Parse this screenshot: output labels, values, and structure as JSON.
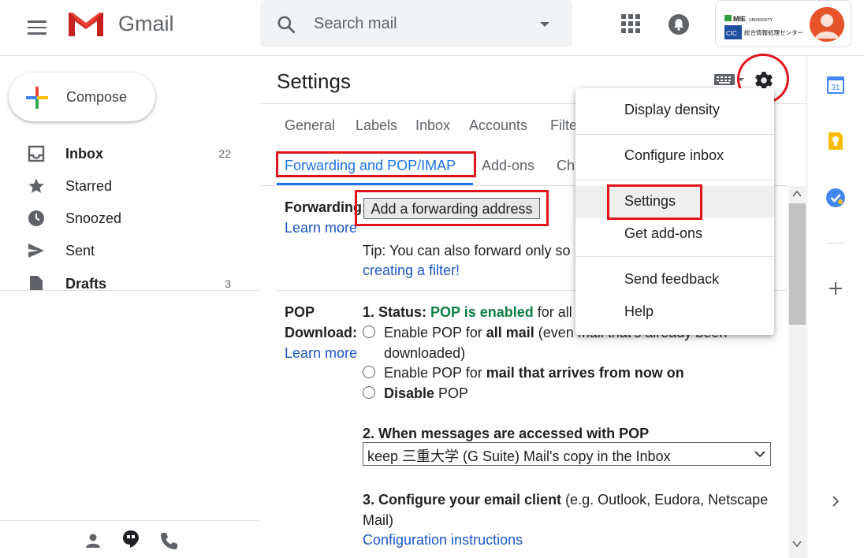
{
  "header": {
    "app_name": "Gmail",
    "search_placeholder": "Search mail",
    "org_logo_text": "MIE UNIVERSITY 総合情報処理センター"
  },
  "sidebar": {
    "compose_label": "Compose",
    "items": [
      {
        "label": "Inbox",
        "count": "22",
        "bold": true,
        "icon": "inbox-icon"
      },
      {
        "label": "Starred",
        "count": "",
        "bold": false,
        "icon": "star-icon"
      },
      {
        "label": "Snoozed",
        "count": "",
        "bold": false,
        "icon": "clock-icon"
      },
      {
        "label": "Sent",
        "count": "",
        "bold": false,
        "icon": "send-icon"
      },
      {
        "label": "Drafts",
        "count": "3",
        "bold": true,
        "icon": "draft-icon"
      }
    ]
  },
  "settings": {
    "title": "Settings",
    "tabs_row1": [
      "General",
      "Labels",
      "Inbox",
      "Accounts",
      "Filte"
    ],
    "tabs_row2": [
      "Forwarding and POP/IMAP",
      "Add-ons",
      "Ch"
    ],
    "forwarding": {
      "label": "Forwarding:",
      "learn_more": "Learn more",
      "button": "Add a forwarding address",
      "tip": "Tip: You can also forward only so",
      "filter_link": "creating a filter!"
    },
    "pop": {
      "label_line1": "POP",
      "label_line2": "Download:",
      "learn_more": "Learn more",
      "status_prefix": "1. Status: ",
      "status_value": "POP is enabled",
      "status_suffix": " for all m",
      "option1_prefix": "Enable POP for ",
      "option1_bold": "all mail",
      "option1_suffix": " (even mail that's already been",
      "option1_line2": "downloaded)",
      "option2_prefix": "Enable POP for ",
      "option2_bold": "mail that arrives from now on",
      "option3_bold": "Disable",
      "option3_suffix": " POP",
      "access_heading": "2. When messages are accessed with POP",
      "access_value": "keep 三重大学 (G Suite) Mail's copy in the Inbox",
      "configure_heading": "3. Configure your email client",
      "configure_suffix": " (e.g. Outlook, Eudora, Netscape",
      "configure_line2": "Mail)",
      "config_link": "Configuration instructions"
    }
  },
  "menu": {
    "items": [
      "Display density",
      "Configure inbox",
      "Settings",
      "Get add-ons",
      "Send feedback",
      "Help"
    ],
    "highlighted": "Settings"
  },
  "right_panel": {
    "calendar_day": "31"
  },
  "colors": {
    "accent_blue": "#1a73e8",
    "annotation_red": "#e0141b",
    "pop_enabled_green": "#0b8043",
    "avatar": "#e8542a"
  }
}
